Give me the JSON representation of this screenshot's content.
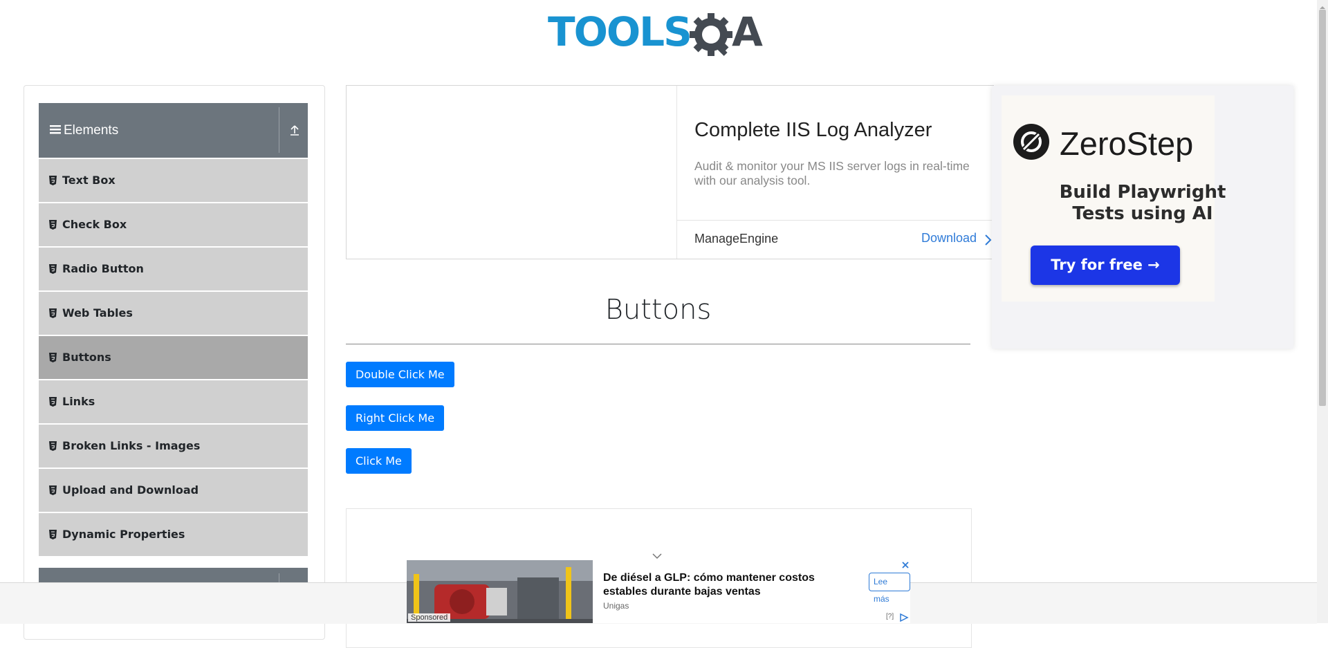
{
  "header": {
    "logo_alt": "TOOLSQA",
    "logo_part1": "TOOLS",
    "logo_part2": "A"
  },
  "sidebar": {
    "group_title": "Elements",
    "items": [
      {
        "label": "Text Box",
        "active": false
      },
      {
        "label": "Check Box",
        "active": false
      },
      {
        "label": "Radio Button",
        "active": false
      },
      {
        "label": "Web Tables",
        "active": false
      },
      {
        "label": "Buttons",
        "active": true
      },
      {
        "label": "Links",
        "active": false
      },
      {
        "label": "Broken Links - Images",
        "active": false
      },
      {
        "label": "Upload and Download",
        "active": false
      },
      {
        "label": "Dynamic Properties",
        "active": false
      }
    ]
  },
  "top_ad": {
    "title": "Complete IIS Log Analyzer",
    "description": "Audit & monitor your MS IIS server logs in real-time with our analysis tool.",
    "brand": "ManageEngine",
    "cta": "Download"
  },
  "side_ad": {
    "brand": "ZeroStep",
    "tagline_line1": "Build Playwright",
    "tagline_line2": "Tests using AI",
    "cta": "Try for free →"
  },
  "main": {
    "title": "Buttons",
    "buttons": {
      "double_click": "Double Click Me",
      "right_click": "Right Click Me",
      "click": "Click Me"
    }
  },
  "footer_ad": {
    "sponsored": "Sponsored",
    "headline": "De diésel a GLP: cómo mantener costos estables durante bajas ventas",
    "source": "Unigas",
    "cta": "Lee más",
    "help": "[?]"
  },
  "colors": {
    "primary_button": "#007bff",
    "sidebar_header": "#6c757d",
    "sidebar_item": "#d0d0d0",
    "sidebar_item_active": "#a9a9a9",
    "logo_blue": "#1993d1",
    "zerostep_button": "#1c36e6"
  }
}
